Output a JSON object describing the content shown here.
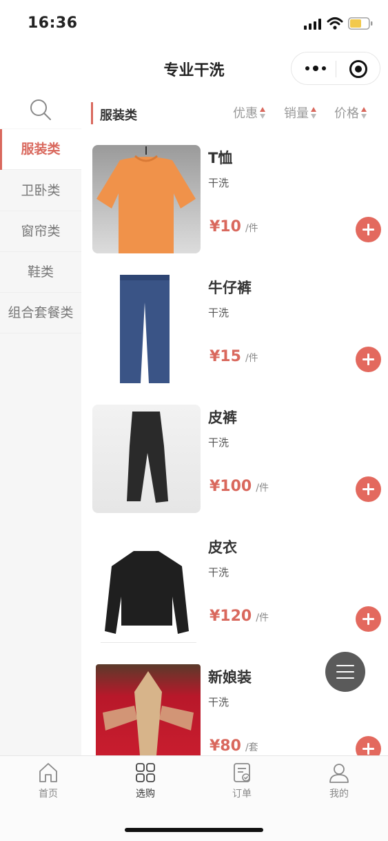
{
  "status_bar": {
    "time": "16:36"
  },
  "nav": {
    "title": "专业干洗"
  },
  "sidebar": {
    "items": [
      {
        "label": "服装类",
        "active": true
      },
      {
        "label": "卫卧类",
        "active": false
      },
      {
        "label": "窗帘类",
        "active": false
      },
      {
        "label": "鞋类",
        "active": false
      },
      {
        "label": "组合套餐类",
        "active": false
      }
    ]
  },
  "content": {
    "category_title": "服装类",
    "sort_options": [
      {
        "label": "优惠"
      },
      {
        "label": "销量"
      },
      {
        "label": "价格"
      }
    ],
    "products": [
      {
        "name": "T恤",
        "service": "干洗",
        "price": "¥10",
        "unit": "/件"
      },
      {
        "name": "牛仔裤",
        "service": "干洗",
        "price": "¥15",
        "unit": "/件"
      },
      {
        "name": "皮裤",
        "service": "干洗",
        "price": "¥100",
        "unit": "/件"
      },
      {
        "name": "皮衣",
        "service": "干洗",
        "price": "¥120",
        "unit": "/件"
      },
      {
        "name": "新娘装",
        "service": "干洗",
        "price": "¥80",
        "unit": "/套"
      }
    ]
  },
  "tab_bar": {
    "tabs": [
      {
        "label": "首页",
        "icon": "home-icon"
      },
      {
        "label": "选购",
        "icon": "grid-icon",
        "active": true
      },
      {
        "label": "订单",
        "icon": "order-icon"
      },
      {
        "label": "我的",
        "icon": "user-icon"
      }
    ]
  },
  "colors": {
    "accent": "#d9685d",
    "add_button": "#e3695e",
    "sidebar_bg": "#f6f6f6"
  }
}
